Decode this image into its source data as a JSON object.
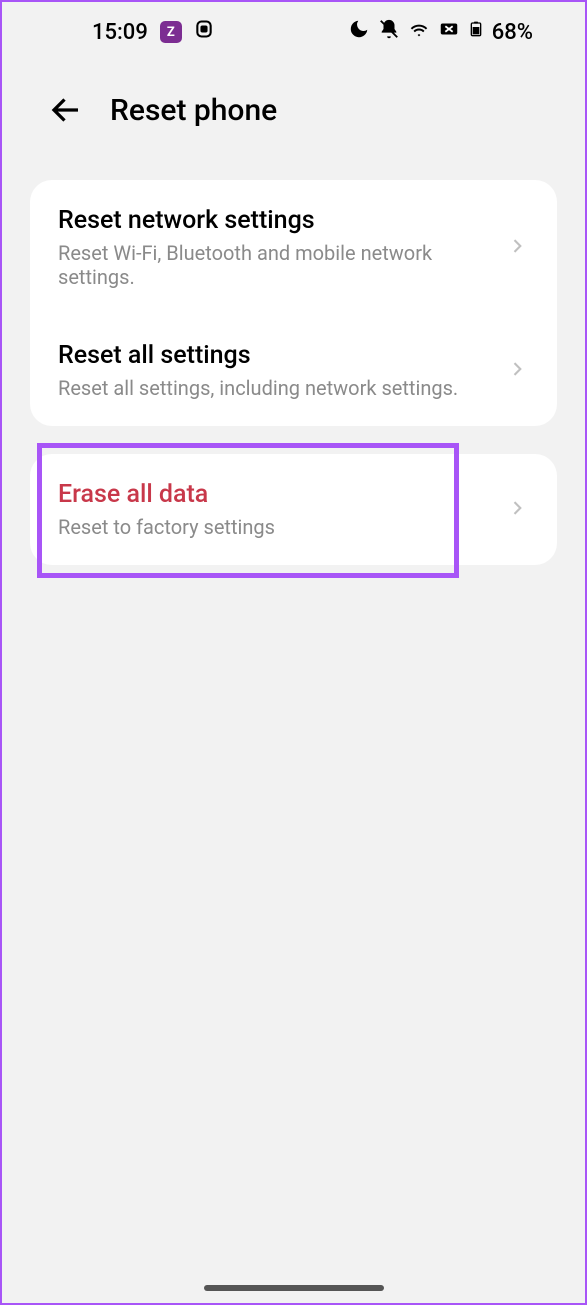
{
  "statusBar": {
    "time": "15:09",
    "appIconLabel": "Z",
    "batteryPercent": "68%"
  },
  "header": {
    "title": "Reset phone"
  },
  "groups": [
    {
      "items": [
        {
          "title": "Reset network settings",
          "subtitle": "Reset Wi-Fi, Bluetooth and mobile network settings.",
          "danger": false
        },
        {
          "title": "Reset all settings",
          "subtitle": "Reset all settings, including network settings.",
          "danger": false
        }
      ]
    },
    {
      "items": [
        {
          "title": "Erase all data",
          "subtitle": "Reset to factory settings",
          "danger": true
        }
      ]
    }
  ]
}
